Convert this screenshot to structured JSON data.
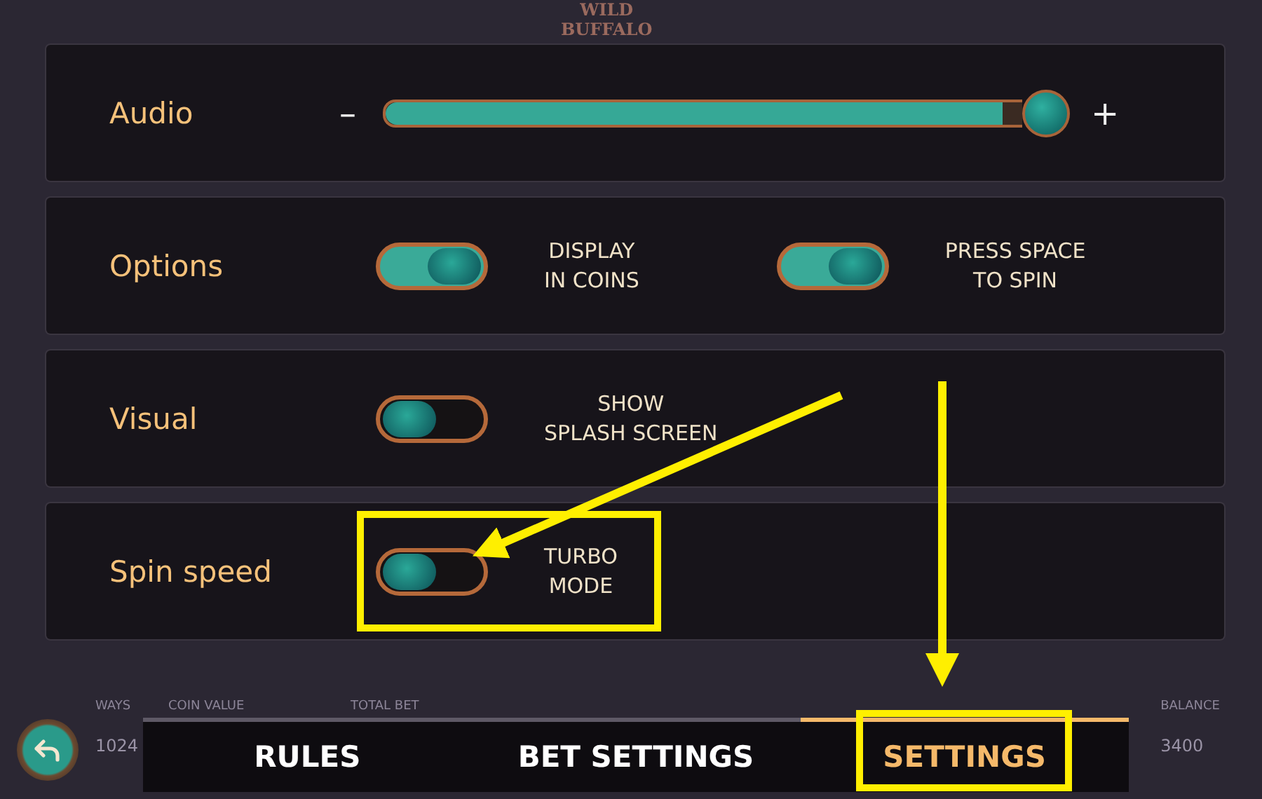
{
  "logo": {
    "line_1": "WILD",
    "line_2": "BUFFALO"
  },
  "sections": [
    {
      "label": "Audio",
      "kind": "slider",
      "minus": "–",
      "plus": "+",
      "level": 0.97
    },
    {
      "label": "Options",
      "kind": "toggles",
      "toggles": [
        {
          "text": "DISPLAY\nIN COINS",
          "on": true
        },
        {
          "text": "PRESS SPACE\nTO SPIN",
          "on": true
        }
      ]
    },
    {
      "label": "Visual",
      "kind": "toggles",
      "toggles": [
        {
          "text": "SHOW\nSPLASH SCREEN",
          "on": false
        }
      ]
    },
    {
      "label": "Spin speed",
      "kind": "toggles",
      "toggles": [
        {
          "text": "TURBO\nMODE",
          "on": false
        }
      ]
    }
  ],
  "background_bar": [
    {
      "label": "WAYS",
      "value": "1024"
    },
    {
      "label": "COIN VALUE"
    },
    {
      "label": "TOTAL BET"
    },
    {
      "label": "BALANCE",
      "value": "3400"
    }
  ],
  "tabs": [
    {
      "label": "RULES",
      "selected": false
    },
    {
      "label": "BET SETTINGS",
      "selected": false
    },
    {
      "label": "SETTINGS",
      "selected": true
    }
  ]
}
